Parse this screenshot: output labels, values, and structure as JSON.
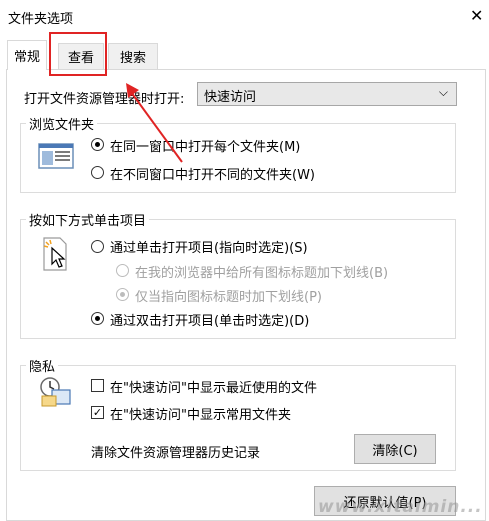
{
  "window": {
    "title": "文件夹选项",
    "close_glyph": "✕"
  },
  "tabs": [
    {
      "label": "常规",
      "active": true
    },
    {
      "label": "查看",
      "active": false,
      "highlighted": true
    },
    {
      "label": "搜索",
      "active": false
    }
  ],
  "general": {
    "open_label": "打开文件资源管理器时打开:",
    "open_select": {
      "value": "快速访问"
    },
    "browse": {
      "legend": "浏览文件夹",
      "options": [
        {
          "label": "在同一窗口中打开每个文件夹(M)",
          "checked": true
        },
        {
          "label": "在不同窗口中打开不同的文件夹(W)",
          "checked": false
        }
      ]
    },
    "click": {
      "legend": "按如下方式单击项目",
      "options": [
        {
          "label": "通过单击打开项目(指向时选定)(S)",
          "checked": false
        },
        {
          "label": "在我的浏览器中给所有图标标题加下划线(B)",
          "checked": false,
          "disabled": true
        },
        {
          "label": "仅当指向图标标题时加下划线(P)",
          "checked": true,
          "disabled": true
        },
        {
          "label": "通过双击打开项目(单击时选定)(D)",
          "checked": true
        }
      ]
    },
    "privacy": {
      "legend": "隐私",
      "recent_files": {
        "label": "在\"快速访问\"中显示最近使用的文件",
        "checked": false
      },
      "frequent_folders": {
        "label": "在\"快速访问\"中显示常用文件夹",
        "checked": true,
        "mark": "✓"
      },
      "clear_label": "清除文件资源管理器历史记录",
      "clear_button": "清除(C)"
    },
    "restore_button": "还原默认值(P)"
  },
  "watermark": "www.xitaimin...",
  "colors": {
    "highlight": "#e02424",
    "arrow": "#e02424"
  }
}
